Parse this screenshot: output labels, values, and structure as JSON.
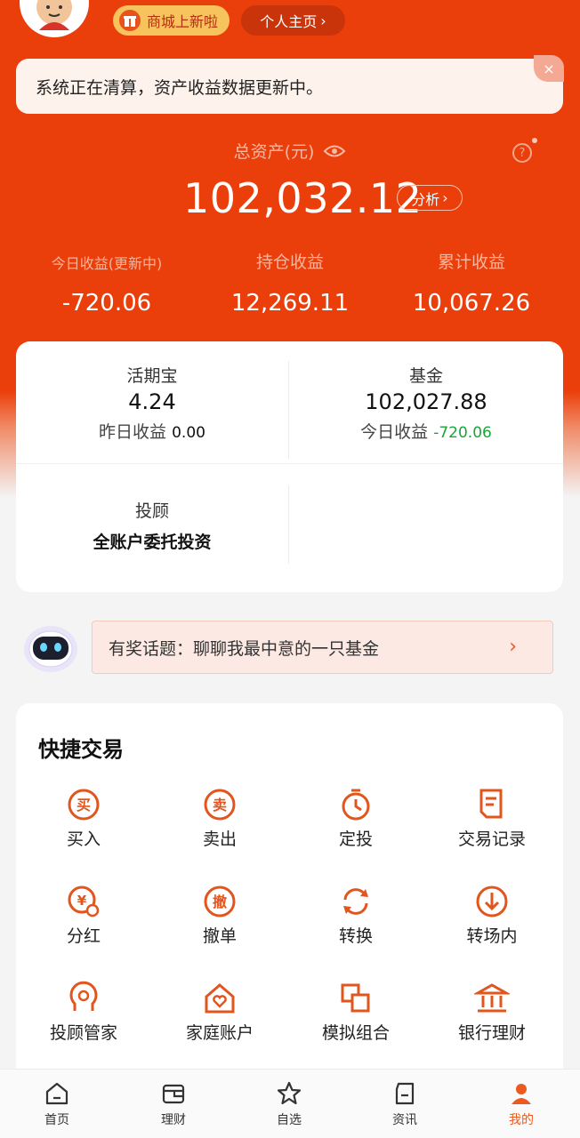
{
  "header": {
    "mall_label": "商城上新啦",
    "home_label": "个人主页"
  },
  "notice": {
    "text": "系统正在清算，资产收益数据更新中。",
    "close": "×"
  },
  "summary": {
    "total_label": "总资产(元)",
    "total_value": "102,032.12",
    "analyze_label": "分析",
    "help": "?",
    "stats": [
      {
        "label": "今日收益(更新中)",
        "value": "-720.06"
      },
      {
        "label": "持仓收益",
        "value": "12,269.11"
      },
      {
        "label": "累计收益",
        "value": "10,067.26"
      }
    ]
  },
  "assets": {
    "huoqibao": {
      "title": "活期宝",
      "value": "4.24",
      "sub_label": "昨日收益",
      "sub_value": "0.00"
    },
    "fund": {
      "title": "基金",
      "value": "102,027.88",
      "sub_label": "今日收益",
      "sub_value": "-720.06"
    },
    "advisor": {
      "title": "投顾",
      "value": "全账户委托投资"
    }
  },
  "topic": {
    "text": "有奖话题：聊聊我最中意的一只基金",
    "arrow": "›"
  },
  "quick": {
    "title": "快捷交易",
    "items": [
      {
        "label": "买入",
        "icon": "buy-icon"
      },
      {
        "label": "卖出",
        "icon": "sell-icon"
      },
      {
        "label": "定投",
        "icon": "timer-icon"
      },
      {
        "label": "交易记录",
        "icon": "record-icon"
      },
      {
        "label": "分红",
        "icon": "dividend-icon"
      },
      {
        "label": "撤单",
        "icon": "cancel-order-icon"
      },
      {
        "label": "转换",
        "icon": "convert-icon"
      },
      {
        "label": "转场内",
        "icon": "transfer-in-icon"
      },
      {
        "label": "投顾管家",
        "icon": "advisor-butler-icon"
      },
      {
        "label": "家庭账户",
        "icon": "family-account-icon"
      },
      {
        "label": "模拟组合",
        "icon": "simulated-portfolio-icon"
      },
      {
        "label": "银行理财",
        "icon": "bank-icon"
      }
    ],
    "glyphs": {
      "buy": "买",
      "sell": "卖",
      "cancel": "撤",
      "yen": "¥"
    }
  },
  "tabbar": {
    "tabs": [
      {
        "label": "首页",
        "icon": "home-icon"
      },
      {
        "label": "理财",
        "icon": "wallet-icon"
      },
      {
        "label": "自选",
        "icon": "star-icon"
      },
      {
        "label": "资讯",
        "icon": "news-icon"
      },
      {
        "label": "我的",
        "icon": "profile-icon",
        "active": true
      }
    ]
  },
  "colors": {
    "brand": "#eb3f0b",
    "accent": "#eb5a1e",
    "gain_green": "#1aa43a"
  }
}
